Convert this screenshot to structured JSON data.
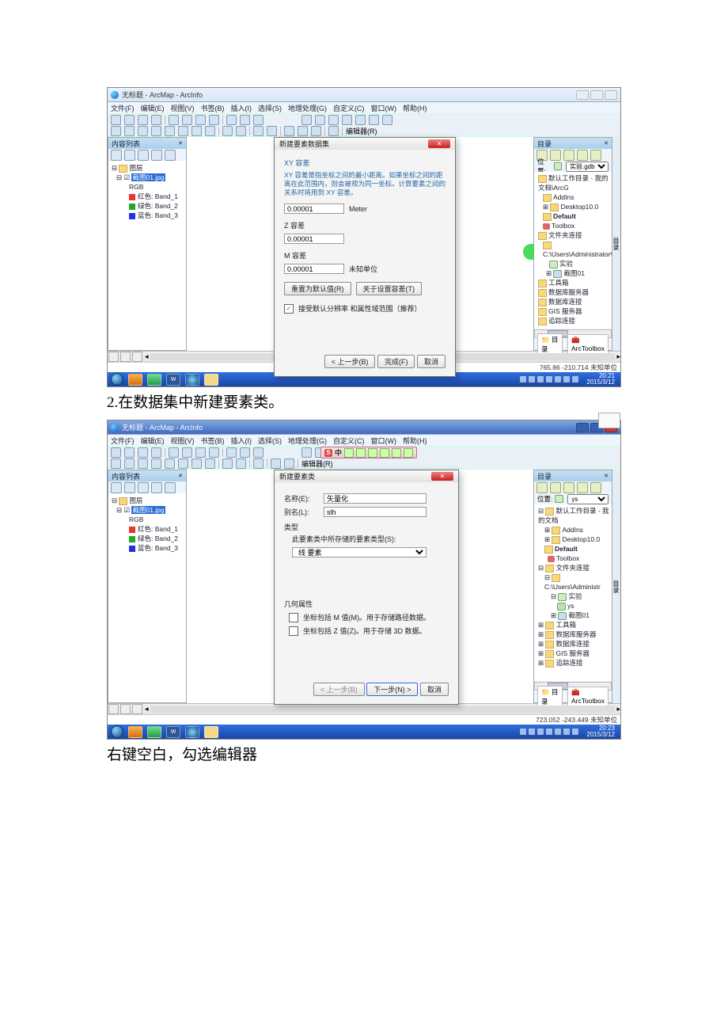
{
  "caption1": "2.在数据集中新建要素类。",
  "caption2": "右键空白，勾选编辑器",
  "screenshot1": {
    "window_title": "无标题 - ArcMap - ArcInfo",
    "menu": [
      "文件(F)",
      "编辑(E)",
      "视图(V)",
      "书签(B)",
      "插入(I)",
      "选择(S)",
      "地理处理(G)",
      "自定义(C)",
      "窗口(W)",
      "帮助(H)"
    ],
    "editor_label": "编辑器(R)",
    "toc_title": "内容列表",
    "toc_close": "✕",
    "toc_pin": "📌 ×",
    "layers_root": "图层",
    "layer_selected": "截图01.jpg",
    "rgb_label": "RGB",
    "bands": [
      {
        "color": "red",
        "label": "红色: Band_1"
      },
      {
        "color": "green",
        "label": "绿色: Band_2"
      },
      {
        "color": "blue",
        "label": "蓝色: Band_3"
      }
    ],
    "dialog": {
      "title": "新建要素数据集",
      "section": "XY 容差",
      "desc": "XY 容差是指坐标之间的最小距离。如果坐标之间的距离在此范围内，则会被视为同一坐标。计算要素之间的关系时将用到 XY 容差。",
      "z_label": "Z 容差",
      "m_label": "M 容差",
      "val": "0.00001",
      "meter": "Meter",
      "unknown_unit": "未知单位",
      "reset_btn": "重置为默认值(R)",
      "about_btn": "关于设置容差(T)",
      "checkbox_label": "接受默认分辨率 和属性域范围（推荐）",
      "back_btn": "< 上一步(B)",
      "finish_btn": "完成(F)",
      "cancel_btn": "取消"
    },
    "catalog": {
      "title": "目录",
      "panel_pin": "📌 ×",
      "side_text": "目录",
      "loc_label": "位置:",
      "loc_value": "实验.gdb",
      "items": [
        {
          "icon": "folder",
          "label": "默认工作目录 - 我的文档\\ArcG"
        },
        {
          "icon": "folder",
          "label": "AddIns"
        },
        {
          "icon": "folder",
          "label": "Desktop10.0"
        },
        {
          "icon": "folder",
          "label": "Default",
          "bold": true
        },
        {
          "icon": "tool",
          "label": "Toolbox"
        },
        {
          "icon": "folder",
          "label": "文件夹连接"
        },
        {
          "icon": "folder",
          "label": "C:\\Users\\Administrator\\D"
        },
        {
          "icon": "db",
          "label": "实验"
        },
        {
          "icon": "db",
          "label": "截图01"
        },
        {
          "icon": "folder",
          "label": "工具箱"
        },
        {
          "icon": "folder",
          "label": "数据库服务器"
        },
        {
          "icon": "folder",
          "label": "数据库连接"
        },
        {
          "icon": "folder",
          "label": "GIS 服务器"
        },
        {
          "icon": "folder",
          "label": "追踪连接"
        }
      ],
      "tab_catalog": "目录",
      "tab_toolbox": "ArcToolbox"
    },
    "status_coords": "765.86  -210.714 未知单位",
    "taskbar_time": "20:21",
    "taskbar_date": "2015/3/12"
  },
  "screenshot2": {
    "window_title": "无标题 - ArcMap - ArcInfo",
    "menu": [
      "文件(F)",
      "编辑(E)",
      "视图(V)",
      "书签(B)",
      "插入(I)",
      "选择(S)",
      "地理处理(G)",
      "自定义(C)",
      "窗口(W)",
      "帮助(H)"
    ],
    "editor_label": "编辑器(R)",
    "toc_title": "内容列表",
    "layers_root": "图层",
    "layer_selected": "截图01.jpg",
    "rgb_label": "RGB",
    "bands": [
      {
        "color": "red",
        "label": "红色: Band_1"
      },
      {
        "color": "green",
        "label": "绿色: Band_2"
      },
      {
        "color": "blue",
        "label": "蓝色: Band_3"
      }
    ],
    "ime_s": "S",
    "ime_zh": "中",
    "dialog": {
      "title": "新建要素类",
      "name_label": "名称(E):",
      "name_value": "矢量化",
      "alias_label": "别名(L):",
      "alias_value": "slh",
      "type_label": "类型",
      "type_desc": "此要素类中所存储的要素类型(S):",
      "feature_type": "线 要素",
      "geom_label": "几何属性",
      "geom_m": "坐标包括 M 值(M)。用于存储路径数据。",
      "geom_z": "坐标包括 Z 值(Z)。用于存储 3D 数据。",
      "back_btn": "< 上一步(B)",
      "next_btn": "下一步(N) >",
      "cancel_btn": "取消"
    },
    "catalog": {
      "title": "目录",
      "loc_label": "位置:",
      "loc_value": "ys",
      "items": [
        {
          "icon": "folder",
          "label": "默认工作目录 - 我的文档"
        },
        {
          "icon": "folder",
          "label": "AddIns"
        },
        {
          "icon": "folder",
          "label": "Desktop10.0"
        },
        {
          "icon": "folder",
          "label": "Default",
          "bold": true
        },
        {
          "icon": "tool",
          "label": "Toolbox"
        },
        {
          "icon": "folder",
          "label": "文件夹连接"
        },
        {
          "icon": "folder",
          "label": "C:\\Users\\Administr"
        },
        {
          "icon": "db",
          "label": "实验"
        },
        {
          "icon": "db",
          "label": "ys"
        },
        {
          "icon": "db",
          "label": "截图01"
        },
        {
          "icon": "folder",
          "label": "工具箱"
        },
        {
          "icon": "folder",
          "label": "数据库服务器"
        },
        {
          "icon": "folder",
          "label": "数据库连接"
        },
        {
          "icon": "folder",
          "label": "GIS 服务器"
        },
        {
          "icon": "folder",
          "label": "追踪连接"
        }
      ],
      "tab_catalog": "目录",
      "tab_toolbox": "ArcToolbox"
    },
    "status_coords": "723.052  -243.449 未知单位",
    "taskbar_time": "20:23",
    "taskbar_date": "2015/3/12"
  }
}
